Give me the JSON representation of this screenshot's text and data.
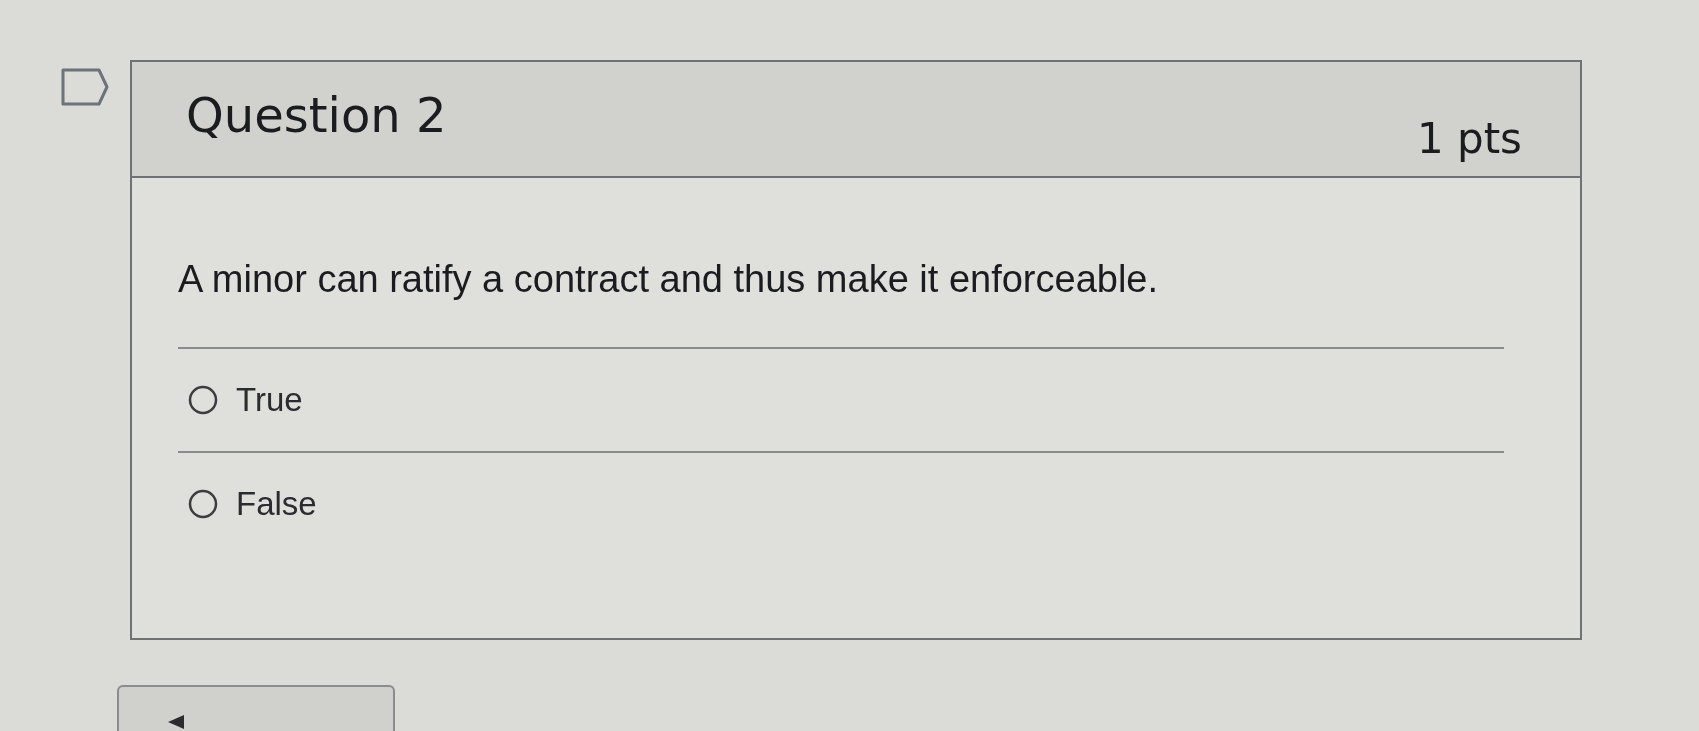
{
  "question": {
    "title": "Question 2",
    "points": "1 pts",
    "text": "A minor can ratify a contract and thus make it enforceable.",
    "answers": [
      {
        "label": "True",
        "selected": false
      },
      {
        "label": "False",
        "selected": false
      }
    ]
  }
}
